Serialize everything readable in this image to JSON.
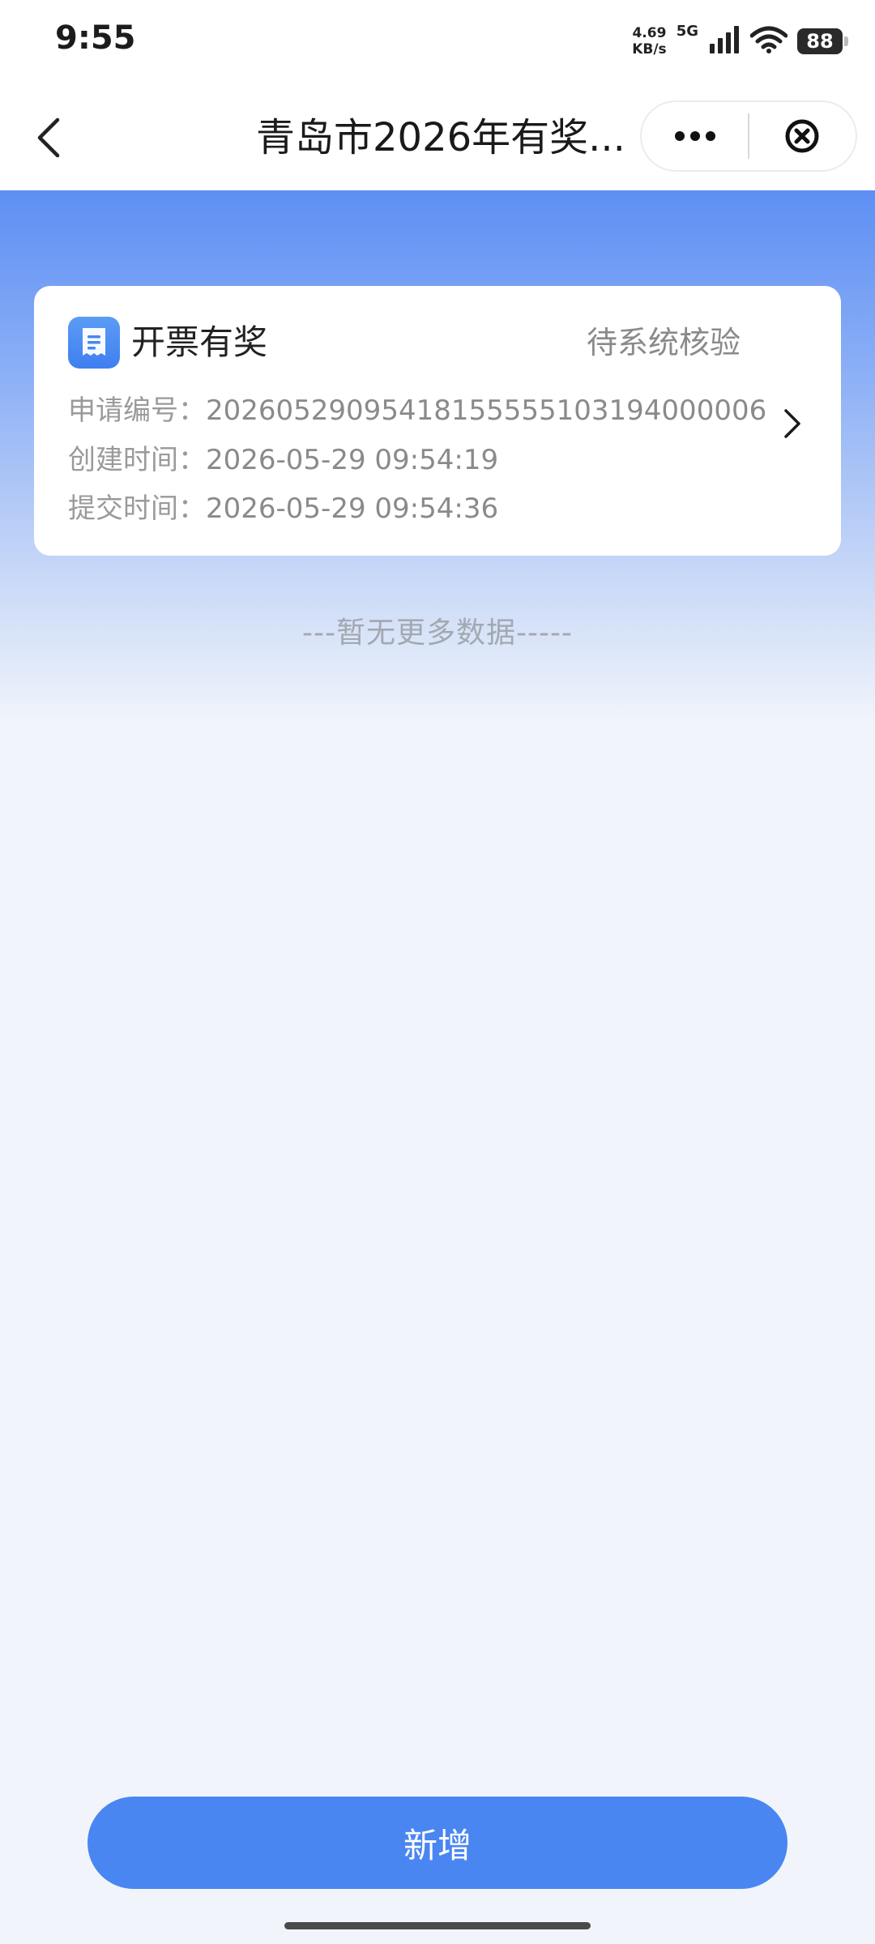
{
  "status_bar": {
    "time": "9:55",
    "net_speed_value": "4.69",
    "net_speed_unit": "KB/s",
    "network_type": "5G",
    "battery": "88"
  },
  "nav": {
    "title": "青岛市2026年有奖..."
  },
  "card": {
    "title": "开票有奖",
    "status": "待系统核验",
    "rows": [
      {
        "label": "申请编号：",
        "value": "20260529095418155555103194000006"
      },
      {
        "label": "创建时间：",
        "value": "2026-05-29 09:54:19"
      },
      {
        "label": "提交时间：",
        "value": "2026-05-29 09:54:36"
      }
    ]
  },
  "no_more_text": "---暂无更多数据-----",
  "add_button_label": "新增",
  "colors": {
    "primary": "#4a86f1",
    "gradient_top": "#5d8ff4",
    "page_bg": "#f1f5fb"
  }
}
